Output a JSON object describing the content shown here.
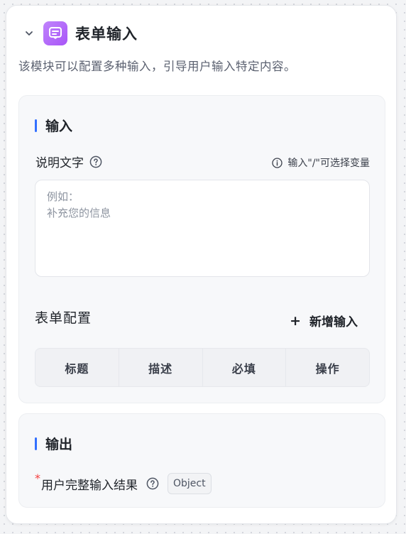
{
  "node": {
    "title": "表单输入",
    "description": "该模块可以配置多种输入，引导用户输入特定内容。",
    "icon": "form-icon",
    "icon_colors": [
      "#c084fc",
      "#a855f7"
    ]
  },
  "input_section": {
    "title": "输入",
    "field_label": "说明文字",
    "hint": "输入\"/\"可选择变量",
    "placeholder_line1": "例如：",
    "placeholder_line2": "补充您的信息",
    "form_config_label": "表单配置",
    "add_button_label": "新增输入",
    "columns": [
      "标题",
      "描述",
      "必填",
      "操作"
    ]
  },
  "output_section": {
    "title": "输出",
    "field_label": "用户完整输入结果",
    "required_mark": "*",
    "type_tag": "Object"
  },
  "colors": {
    "accent": "#3370ff",
    "required": "#f53f3f"
  }
}
